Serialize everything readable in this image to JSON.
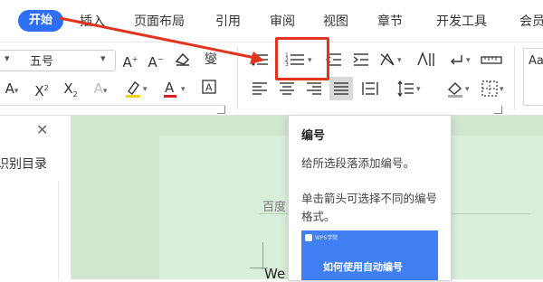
{
  "tabs": {
    "home": "开始",
    "insert": "插入",
    "layout": "页面布局",
    "references": "引用",
    "review": "审阅",
    "view": "视图",
    "section": "章节",
    "developer": "开发工具",
    "member": "会员"
  },
  "font": {
    "size_value": "五号"
  },
  "nav_pane": {
    "title": "识别目录"
  },
  "document": {
    "text_line": "百度",
    "bottom_text": "We"
  },
  "tooltip": {
    "title": "编号",
    "description": "给所选段落添加编号。",
    "hint": "单击箭头可选择不同的编号格式。",
    "preview_header": "WPS学院",
    "preview_caption": "如何使用自动编号"
  },
  "styles_preview": "Aa",
  "colors": {
    "accent": "#2f6ff5",
    "annotation_red": "#e1341e",
    "doc_green": "#d9efd9"
  }
}
